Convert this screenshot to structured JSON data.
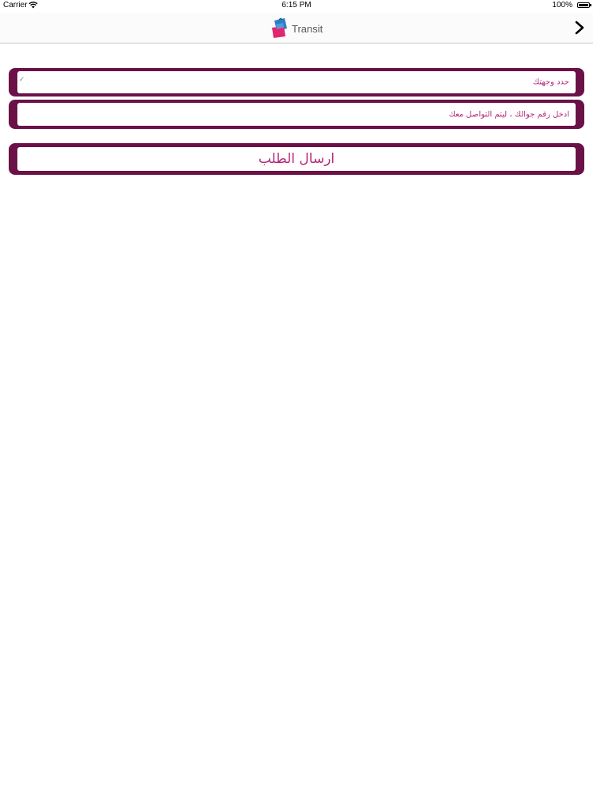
{
  "status_bar": {
    "carrier": "Carrier",
    "time": "6:15 PM",
    "battery": "100%"
  },
  "nav": {
    "title": "Transit",
    "forward_icon": "chevron-right-icon"
  },
  "form": {
    "destination_placeholder": "حدد وجهتك",
    "phone_placeholder": "ادخل رقم جوالك ، ليتم التواصل معك",
    "submit_label": "ارسال الطلب",
    "check_glyph": "✓"
  },
  "colors": {
    "frame": "#6b1148",
    "text_accent": "#b3297a"
  }
}
